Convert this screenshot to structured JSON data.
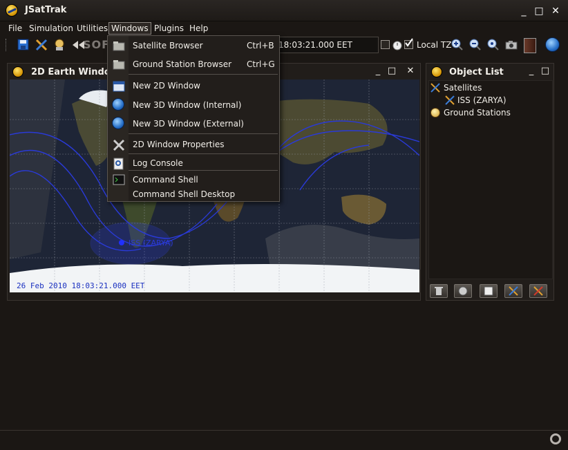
{
  "window": {
    "title": "JSatTrak",
    "min": "_",
    "max": "□",
    "close": "✕"
  },
  "menubar": [
    "File",
    "Simulation",
    "Utilities",
    "Windows",
    "Plugins",
    "Help"
  ],
  "toolbar": {
    "time_value": "18:03:21.000 EET",
    "local_tz_label": "Local TZ",
    "local_tz_checked": true
  },
  "panel_2d": {
    "title": "2D Earth Window",
    "timestamp": "26 Feb 2010 18:03:21.000 EET",
    "sat_label": "ISS (ZARYA)"
  },
  "object_list": {
    "title": "Object List",
    "tree": [
      {
        "label": "Satellites",
        "children": [
          "ISS (ZARYA)"
        ]
      },
      {
        "label": "Ground Stations",
        "children": []
      }
    ]
  },
  "windows_menu": {
    "items": [
      {
        "label": "Satellite Browser",
        "shortcut": "Ctrl+B",
        "icon": "folder-icon"
      },
      {
        "label": "Ground Station Browser",
        "shortcut": "Ctrl+G",
        "icon": "folder-icon"
      },
      {
        "label": "New 2D Window",
        "shortcut": "",
        "icon": "window-icon"
      },
      {
        "label": "New 3D Window (Internal)",
        "shortcut": "",
        "icon": "globe-icon"
      },
      {
        "label": "New 3D Window (External)",
        "shortcut": "",
        "icon": "globe-icon"
      },
      {
        "label": "2D Window Properties",
        "shortcut": "",
        "icon": "tools-icon"
      },
      {
        "label": "Log Console",
        "shortcut": "",
        "icon": "magnifier-icon"
      },
      {
        "label": "Command Shell",
        "shortcut": "",
        "icon": "terminal-icon"
      },
      {
        "label": "Command Shell Desktop",
        "shortcut": "",
        "icon": ""
      }
    ]
  },
  "watermark": "SOFTPEDIA"
}
